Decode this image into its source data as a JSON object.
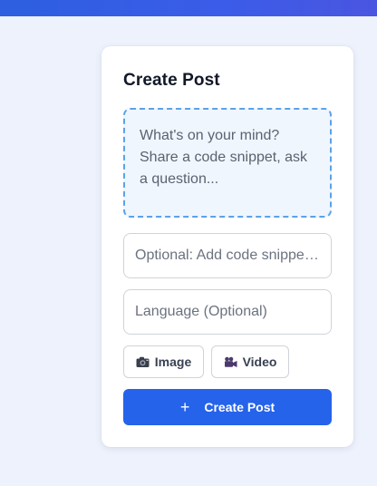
{
  "create_post": {
    "title": "Create Post",
    "post_placeholder": "What's on your mind? Share a code snippet, ask a question...",
    "code_placeholder": "Optional: Add code snippet...",
    "language_placeholder": "Language (Optional)",
    "image_label": "Image",
    "video_label": "Video",
    "submit_label": "Create Post",
    "submit_icon": "+"
  },
  "icons": {
    "image": "camera-icon",
    "video": "video-camera-icon",
    "submit": "plus-icon"
  },
  "colors": {
    "accent": "#2563eb",
    "dashed_border": "#5aa2ea",
    "background": "#eef2fc"
  }
}
